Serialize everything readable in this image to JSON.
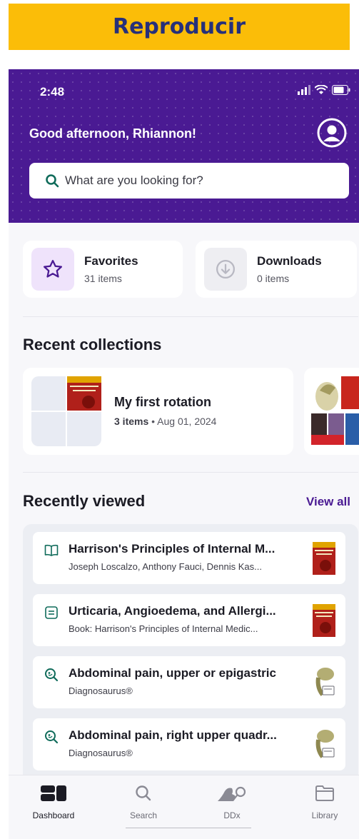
{
  "banner": {
    "label": "Reproducir"
  },
  "status_bar": {
    "time": "2:48",
    "icons": [
      "signal-icon",
      "wifi-icon",
      "battery-icon"
    ]
  },
  "header": {
    "greeting": "Good afternoon, Rhiannon!",
    "avatar_icon": "user-circle-icon"
  },
  "search": {
    "placeholder": "What are you looking for?",
    "icon": "search-icon"
  },
  "quick_access": [
    {
      "title": "Favorites",
      "subtitle": "31 items",
      "icon": "star-icon"
    },
    {
      "title": "Downloads",
      "subtitle": "0 items",
      "icon": "download-icon"
    }
  ],
  "recent_collections": {
    "title": "Recent collections",
    "items": [
      {
        "title": "My first rotation",
        "count": "3 items",
        "date": "Aug 01, 2024"
      }
    ]
  },
  "recently_viewed": {
    "title": "Recently viewed",
    "view_all": "View all",
    "items": [
      {
        "title": "Harrison's Principles of Internal M...",
        "subtitle": "Joseph Loscalzo, Anthony Fauci, Dennis Kas...",
        "icon": "book-icon"
      },
      {
        "title": "Urticaria, Angioedema, and Allergi...",
        "subtitle": "Book: Harrison's Principles of Internal Medic...",
        "icon": "chapter-icon"
      },
      {
        "title": "Abdominal pain, upper or epigastric",
        "subtitle": "Diagnosaurus®",
        "icon": "ddx-search-icon"
      },
      {
        "title": "Abdominal pain, right upper quadr...",
        "subtitle": "Diagnosaurus®",
        "icon": "ddx-search-icon"
      }
    ]
  },
  "tabbar": {
    "items": [
      {
        "label": "Dashboard",
        "icon": "dashboard-icon",
        "active": true
      },
      {
        "label": "Search",
        "icon": "search-icon"
      },
      {
        "label": "DDx",
        "icon": "dinosaur-icon"
      },
      {
        "label": "Library",
        "icon": "folder-icon"
      }
    ]
  },
  "colors": {
    "brand_purple": "#4a1a93",
    "banner_yellow": "#fbbd08",
    "banner_text": "#26307a",
    "search_green": "#0f6b5a"
  }
}
